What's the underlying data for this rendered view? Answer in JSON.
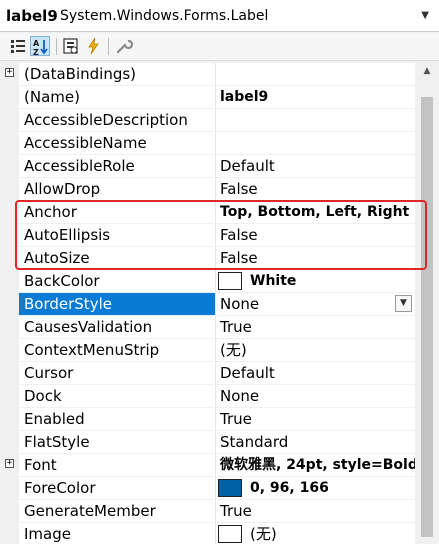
{
  "header": {
    "object_name": "label9",
    "object_type": "System.Windows.Forms.Label"
  },
  "toolbar": {
    "icons": [
      "categorized-icon",
      "alphabetical-icon",
      "properties-icon",
      "events-icon",
      "property-pages-icon"
    ],
    "selected": "alphabetical-icon"
  },
  "properties": [
    {
      "name": "(DataBindings)",
      "value": "",
      "expandable": true
    },
    {
      "name": "(Name)",
      "value": "label9",
      "bold": true
    },
    {
      "name": "AccessibleDescription",
      "value": ""
    },
    {
      "name": "AccessibleName",
      "value": ""
    },
    {
      "name": "AccessibleRole",
      "value": "Default"
    },
    {
      "name": "AllowDrop",
      "value": "False"
    },
    {
      "name": "Anchor",
      "value": "Top, Bottom, Left, Right",
      "bold": true
    },
    {
      "name": "AutoEllipsis",
      "value": "False"
    },
    {
      "name": "AutoSize",
      "value": "False"
    },
    {
      "name": "BackColor",
      "value": "White",
      "bold": true,
      "swatch": "#ffffff"
    },
    {
      "name": "BorderStyle",
      "value": "None",
      "selected": true,
      "combo": true
    },
    {
      "name": "CausesValidation",
      "value": "True"
    },
    {
      "name": "ContextMenuStrip",
      "value": "(无)"
    },
    {
      "name": "Cursor",
      "value": "Default"
    },
    {
      "name": "Dock",
      "value": "None"
    },
    {
      "name": "Enabled",
      "value": "True"
    },
    {
      "name": "FlatStyle",
      "value": "Standard"
    },
    {
      "name": "Font",
      "value": "微软雅黑, 24pt, style=Bold",
      "bold": true,
      "expandable": true
    },
    {
      "name": "ForeColor",
      "value": "0, 96, 166",
      "bold": true,
      "swatch": "#0060a6"
    },
    {
      "name": "GenerateMember",
      "value": "True"
    },
    {
      "name": "Image",
      "value": "(无)",
      "swatch": "#ffffff"
    }
  ],
  "colors": {
    "selection": "#0a7bd5",
    "highlight_box": "#e02626"
  }
}
